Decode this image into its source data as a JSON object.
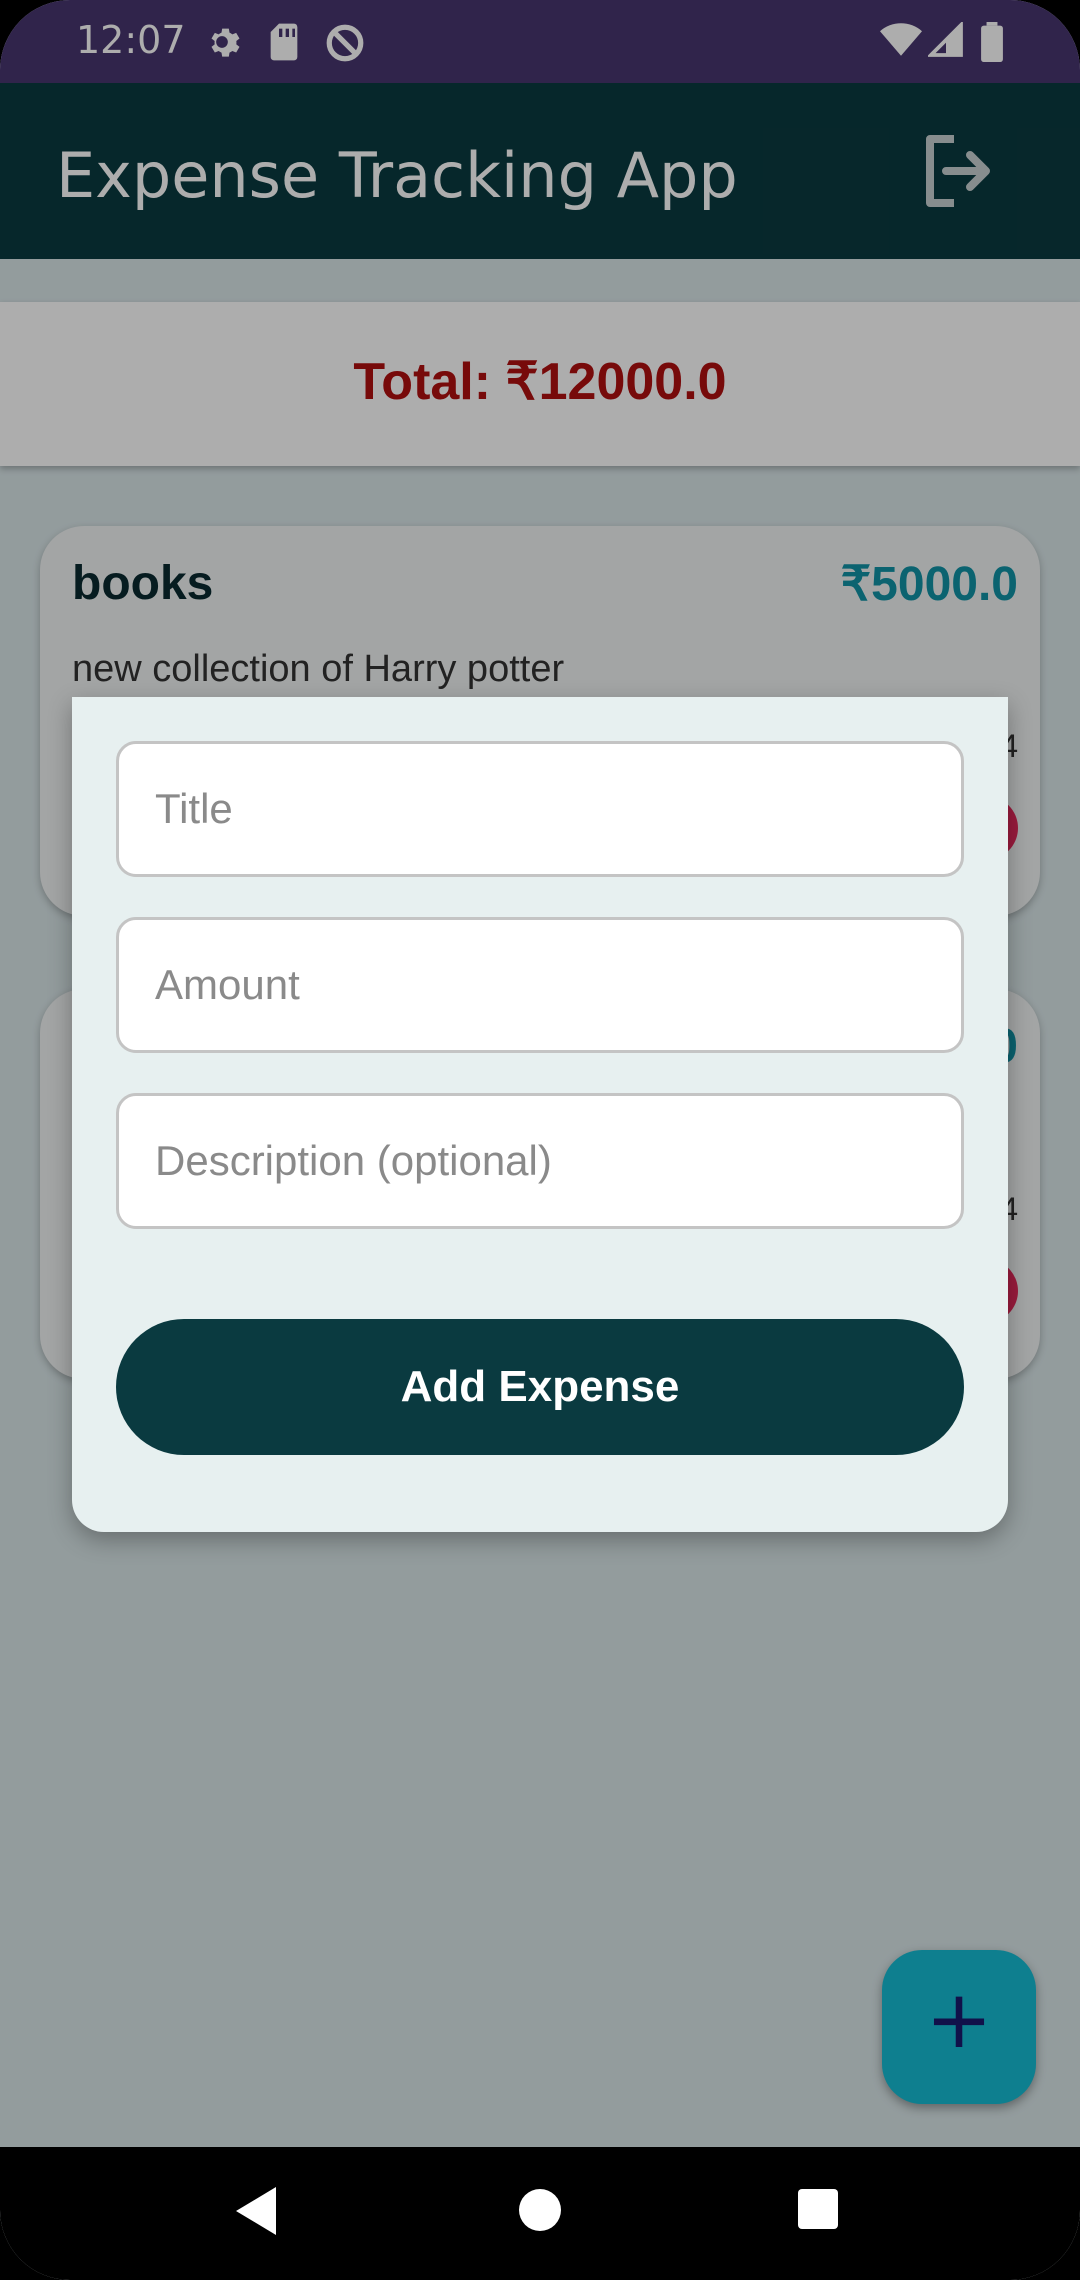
{
  "status_bar": {
    "time": "12:07",
    "left_icons": [
      "settings-icon",
      "sd-card-icon",
      "data-saver-icon"
    ],
    "right_icons": [
      "wifi-icon",
      "signal-icon",
      "battery-icon"
    ]
  },
  "app_bar": {
    "title": "Expense Tracking App",
    "logout_icon": "logout-icon"
  },
  "summary": {
    "total_label": "Total: ₹12000.0"
  },
  "expenses": [
    {
      "title": "books",
      "amount": "₹5000.0",
      "description": "new collection of Harry potter",
      "date": "4"
    },
    {
      "title": "",
      "amount": "0",
      "description": "",
      "date": "4"
    }
  ],
  "dialog": {
    "title_placeholder": "Title",
    "amount_placeholder": "Amount",
    "description_placeholder": "Description (optional)",
    "submit_label": "Add Expense"
  },
  "fab": {
    "label": "+"
  },
  "colors": {
    "status_bar": "#48366f",
    "app_bar": "#0a3a40",
    "total_text": "#b00f10",
    "amount_text": "#1193a6",
    "fab": "#16bcd3",
    "delete": "#e3295a"
  }
}
